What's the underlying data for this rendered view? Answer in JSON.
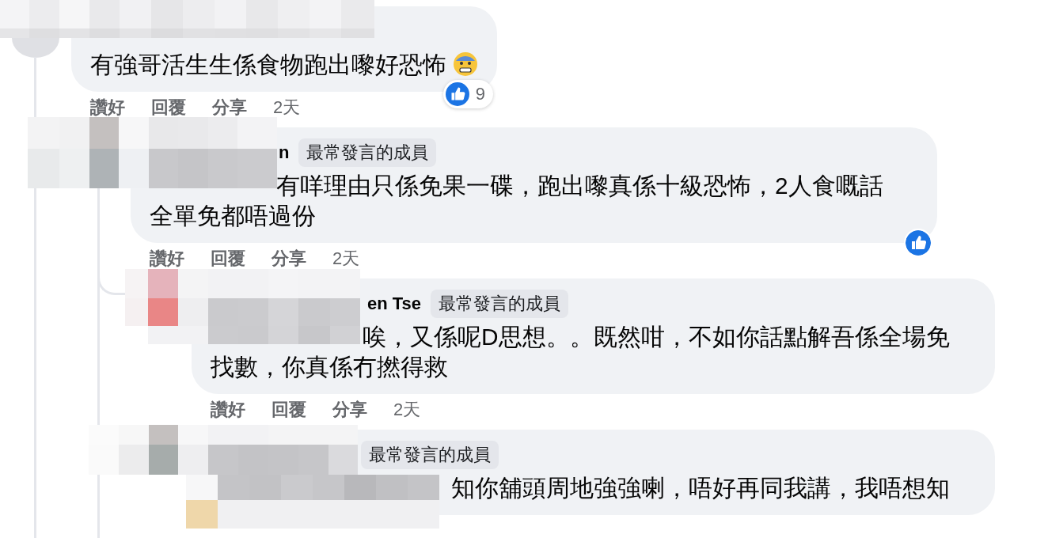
{
  "comments": [
    {
      "text": "有強哥活生生係食物跑出嚟好恐怖",
      "emoji": {
        "kind": "fearful"
      },
      "reaction": {
        "shown": true,
        "count": "9"
      },
      "actions": [
        "讚好",
        "回覆",
        "分享"
      ],
      "time": "2天",
      "children": [
        {
          "author": "n",
          "badge": "最常發言的成員",
          "text": "有咩理由只係免果一碟，跑出嚟真係十級恐怖，2人食嘅話全單免都唔過份",
          "reaction": {
            "shown": true
          },
          "actions": [
            "讚好",
            "回覆",
            "分享"
          ],
          "time": "2天",
          "children": [
            {
              "author": "en Tse",
              "badge": "最常發言的成員",
              "text": "唉，又係呢D思想。。既然咁，不如你話點解吾係全場免找數，你真係冇撚得救",
              "actions": [
                "讚好",
                "回覆",
                "分享"
              ],
              "time": "2天"
            },
            {
              "badge": "最常發言的成員",
              "text": "知你舖頭周地強強喇，唔好再同我講，我唔想知"
            }
          ]
        }
      ]
    }
  ]
}
